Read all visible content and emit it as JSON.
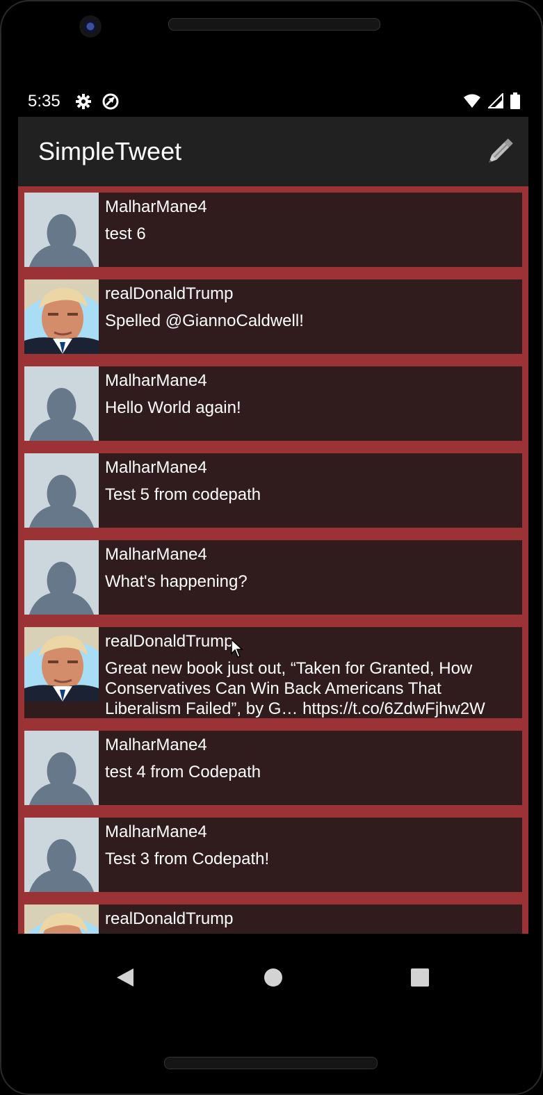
{
  "status_bar": {
    "time": "5:35",
    "left_icons": [
      "settings-icon",
      "no-location-icon"
    ],
    "right_icons": [
      "wifi-icon",
      "cell-signal-icon",
      "battery-icon"
    ]
  },
  "app_bar": {
    "title": "SimpleTweet",
    "compose_icon": "pencil-icon"
  },
  "timeline": {
    "tweets": [
      {
        "handle": "MalharMane4",
        "body": "test 6",
        "avatar": "default-avatar"
      },
      {
        "handle": "realDonaldTrump",
        "body": "Spelled @GiannoCaldwell!",
        "avatar": "profile-photo"
      },
      {
        "handle": "MalharMane4",
        "body": "Hello World again!",
        "avatar": "default-avatar"
      },
      {
        "handle": "MalharMane4",
        "body": "Test 5 from codepath",
        "avatar": "default-avatar"
      },
      {
        "handle": "MalharMane4",
        "body": "What's happening?",
        "avatar": "default-avatar"
      },
      {
        "handle": "realDonaldTrump",
        "body": "Great new book just out, “Taken for Granted, How Conservatives Can Win Back Americans That Liberalism Failed”, by G… https://t.co/6ZdwFjhw2W",
        "avatar": "profile-photo"
      },
      {
        "handle": "MalharMane4",
        "body": "test 4 from Codepath",
        "avatar": "default-avatar"
      },
      {
        "handle": "MalharMane4",
        "body": "Test 3 from Codepath!",
        "avatar": "default-avatar"
      },
      {
        "handle": "realDonaldTrump",
        "body": "",
        "avatar": "profile-photo"
      }
    ]
  },
  "nav_bar": {
    "back_icon": "back-triangle-icon",
    "home_icon": "home-circle-icon",
    "recents_icon": "recents-square-icon"
  },
  "colors": {
    "app_bar": "#212121",
    "timeline_background": "#9b3336",
    "tweet_background": "#311c1d",
    "text": "#ffffff",
    "default_avatar_background": "#ccd6dd",
    "default_avatar_silhouette": "#66788a"
  }
}
